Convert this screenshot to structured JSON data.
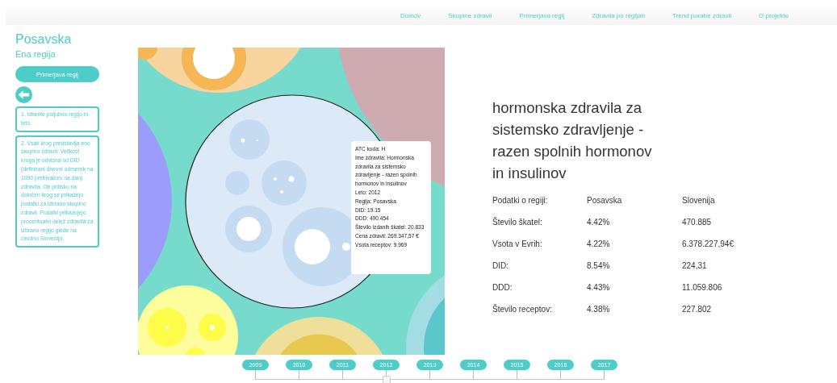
{
  "nav": [
    {
      "label": "Domov"
    },
    {
      "label": "Skupine zdravil"
    },
    {
      "label": "Primerjava regij"
    },
    {
      "label": "Zdravila po regijah"
    },
    {
      "label": "Trend porabe zdravil"
    },
    {
      "label": "O projektu"
    }
  ],
  "sidebar": {
    "title": "Posavska",
    "subtitle": "Ena regija",
    "button": "Primerjava regij",
    "notes": [
      "1. Izberite poljubno regijo in leto.",
      "2. Vsak krog predstavlja eno skupino zdravil. Velikost kroga je odvisna od DID (definirani dnevni odmerek na 1000 prebivalcev na dan) zdravila. Ob pritisku na določen krog se prikažejo podatki za izbrano skupino zdravil. Podatki prikazujejo procentualni delež zdravila za izbrano regijo glede na celotno Slovenijo."
    ]
  },
  "tooltip": {
    "lines": [
      "ATC koda: H",
      "Ime zdravila: Hormonska zdravila za sistemsko zdravljenje - razen spolnih hormonov in insulinov",
      "Leto: 2012",
      "Regija: Posavska",
      "DID: 19.15",
      "DDD: 490.454",
      "Število izdanih škatel: 20.833",
      "Cena zdravil: 269.347,57 €",
      "Vsota receptov: 9.969"
    ]
  },
  "details": {
    "title": "hormonska zdravila za sistemsko zdravljenje - razen spolnih hormonov in insulinov",
    "header": [
      "Podatki o regiji:",
      "Posavska",
      "Slovenija"
    ],
    "rows": [
      [
        "Število škatel:",
        "4.42%",
        "470.885"
      ],
      [
        "Vsota v Evrih:",
        "4.22%",
        "6.378.227,94€"
      ],
      [
        "DID:",
        "8.54%",
        "224,31"
      ],
      [
        "DDD:",
        "4.43%",
        "11.059.806"
      ],
      [
        "Število receptov:",
        "4.38%",
        "227.802"
      ]
    ]
  },
  "timeline": [
    {
      "label": "2009",
      "selected": false
    },
    {
      "label": "2010",
      "selected": false
    },
    {
      "label": "2011",
      "selected": false
    },
    {
      "label": "2012",
      "selected": true
    },
    {
      "label": "2013",
      "selected": false
    },
    {
      "label": "2014",
      "selected": false
    },
    {
      "label": "2015",
      "selected": false
    },
    {
      "label": "2016",
      "selected": false
    },
    {
      "label": "2017",
      "selected": false
    }
  ]
}
